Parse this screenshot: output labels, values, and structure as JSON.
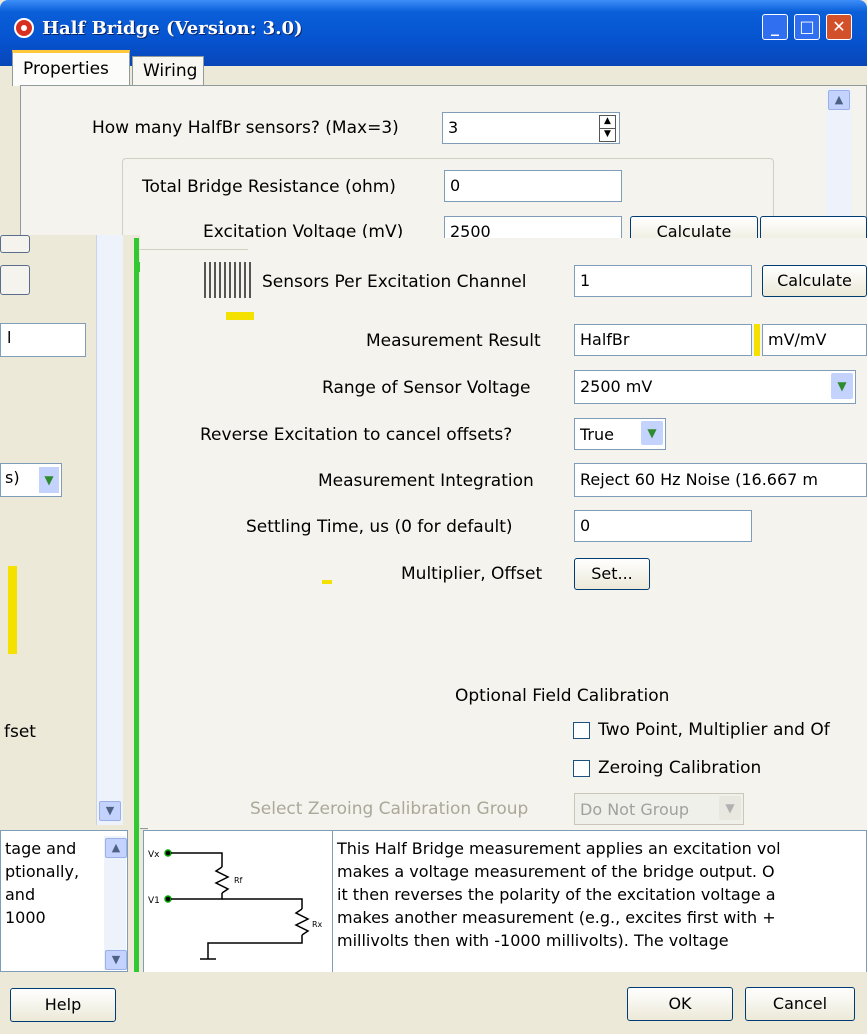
{
  "window": {
    "title": "Half Bridge (Version: 3.0)"
  },
  "tabs": [
    {
      "label": "Properties"
    },
    {
      "label": "Wiring"
    }
  ],
  "form": {
    "num_sensors_label": "How many HalfBr sensors? (Max=3)",
    "num_sensors_value": "3",
    "total_resistance_label": "Total Bridge Resistance (ohm)",
    "total_resistance_value": "0",
    "excitation_voltage_label": "Excitation Voltage (mV)",
    "excitation_voltage_value": "2500",
    "calculate_label": "Calculate",
    "sensors_per_channel_label": "Sensors Per Excitation Channel",
    "sensors_per_channel_value": "1",
    "calculate2_label": "Calculate",
    "measurement_result_label": "Measurement Result",
    "measurement_result_value": "HalfBr",
    "measurement_result_units": "mV/mV",
    "range_label": "Range of Sensor Voltage",
    "range_value": "2500 mV",
    "reverse_label": "Reverse Excitation to cancel offsets?",
    "reverse_value": "True",
    "integration_label": "Measurement Integration",
    "integration_value": "Reject 60 Hz Noise (16.667 m",
    "settling_label": "Settling Time, us (0 for default)",
    "settling_value": "0",
    "multiplier_label": "Multiplier, Offset",
    "set_label": "Set...",
    "calibration_heading": "Optional Field Calibration",
    "two_point_label": "Two Point, Multiplier and Of",
    "zeroing_label": "Zeroing Calibration",
    "zeroing_group_label": "Select Zeroing Calibration Group",
    "zeroing_group_value": "Do Not Group"
  },
  "back_window": {
    "field1": "l",
    "combo_value": "s)",
    "offset_label": "fset",
    "description_lines": [
      "tage and",
      "ptionally,",
      "and",
      "1000"
    ],
    "help_label": "Help"
  },
  "diagram": {
    "vx_label": "Vx",
    "v1_label": "V1",
    "rf_label": "Rf",
    "rx_label": "Rx"
  },
  "description": "This Half Bridge measurement applies an excitation vol\nmakes a voltage measurement of the bridge output. O\nit then reverses the polarity of the excitation voltage a\nmakes another measurement (e.g., excites first with +\nmillivolts then with -1000 millivolts). The voltage",
  "buttons": {
    "ok_label": "OK",
    "cancel_label": "Cancel"
  }
}
